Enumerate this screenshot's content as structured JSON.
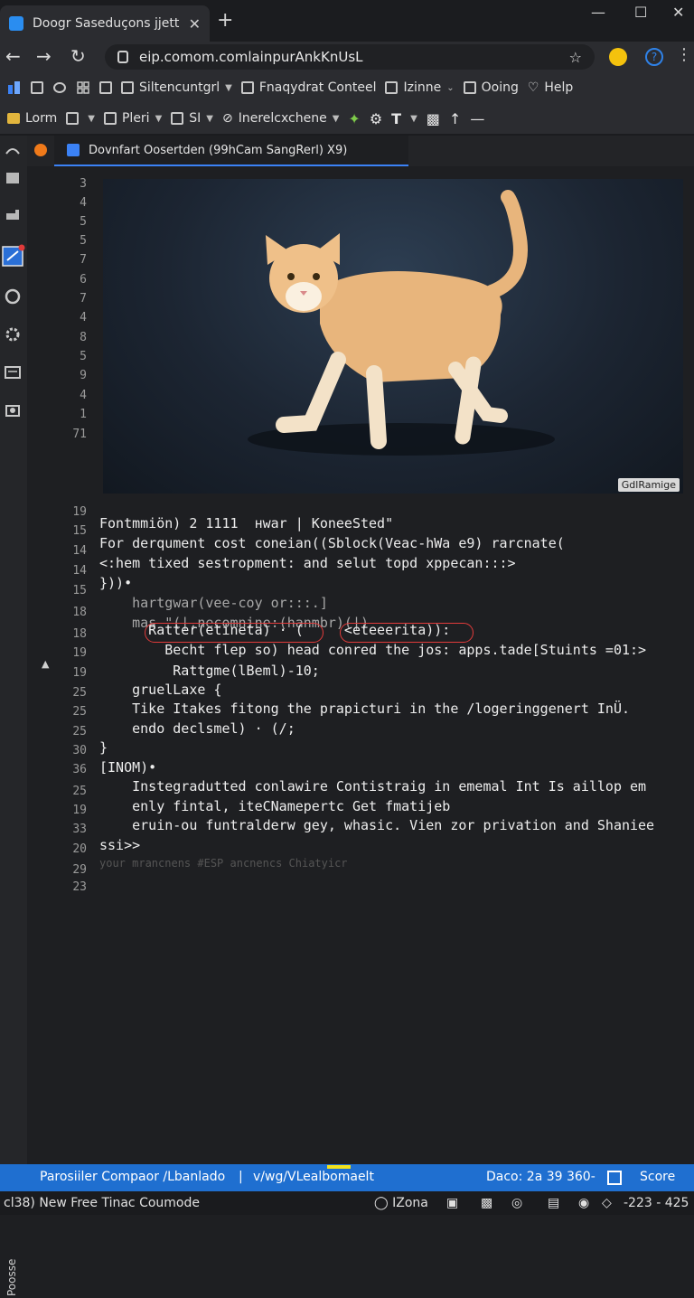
{
  "browser": {
    "tab_title": "Doogr Saseduçons jjett",
    "tab_close": "✕",
    "new_tab": "+",
    "url": "eip.comom.comlainpurAnkKnUsL",
    "window_controls": {
      "minimize": "—",
      "maximize": "☐",
      "close": "✕"
    }
  },
  "menubar1": {
    "items": [
      "Siltencuntgrl",
      "Fnaqydrat Conteel",
      "Izinne",
      "Ooing",
      "Help"
    ]
  },
  "menubar2": {
    "items": [
      "Lorm",
      "Pleri",
      "SI",
      "Inerelcxchene"
    ]
  },
  "editor": {
    "tab_title": "Dovnfart Oosertden (99hCam SangRerl)  X9)",
    "image_watermark": "GdlRamige",
    "line_numbers": [
      "3",
      "4",
      "5",
      "5",
      "7",
      "6",
      "7",
      "4",
      "8",
      "5",
      "9",
      "4",
      "1",
      "71",
      "19",
      "15",
      "14",
      "14",
      "15",
      "18",
      "18",
      "19",
      "19",
      "25",
      "25",
      "25",
      "30",
      "36",
      "25",
      "19",
      "33",
      "20",
      "29",
      "23"
    ],
    "lines": [
      "Fontmmiön) 2 1111  нwar | KoneeSted\"",
      "For derqument cost coneian((Sblock(Veac-hWa e9) rarcnate(",
      "<:hem tixed sestropment: and selut topd xppecan:::>",
      "}))•",
      "    hartgwar(vee-coy or:::.]",
      "    mas \"(|.necomnine:(hanmbr)(|)",
      "      Ratter(etineta) · (     <eteeerita)):",
      "        Becht flep so) head conred the jos: apps.tade[Stuints =01:>",
      "         Rattgme(lBeml)-10;",
      "    gruelLaxe {",
      "    Tike Itakes fitong the prapicturi in the /logeringgenert InÜ.",
      "    endo declsmel) · (/;",
      "}",
      "[INOM)•",
      "    Instegradutted conlawire Contistraig in ememal Int Is aillop em",
      "    enly fintal, iteCNamepertc Get fmatijeb",
      "    eruin-ou funtralderw gey, whasic. Vien zor privation and Shaniee",
      "ssi>>",
      "your mrancnens #ESP ancnencs Chiatyicr"
    ]
  },
  "statusbar": {
    "left": "Parosiiler Compaor /Lbanlado",
    "middle": "v/wg/VLealbomaelt",
    "pos": "Daco: 2a  39 360-",
    "score": "Score"
  },
  "bottombar": {
    "left": "cl38) New Free Tinac Coumode",
    "zona": "IZona",
    "right": "-223 - 425"
  },
  "sidebar_vertical_text": "Poosse"
}
